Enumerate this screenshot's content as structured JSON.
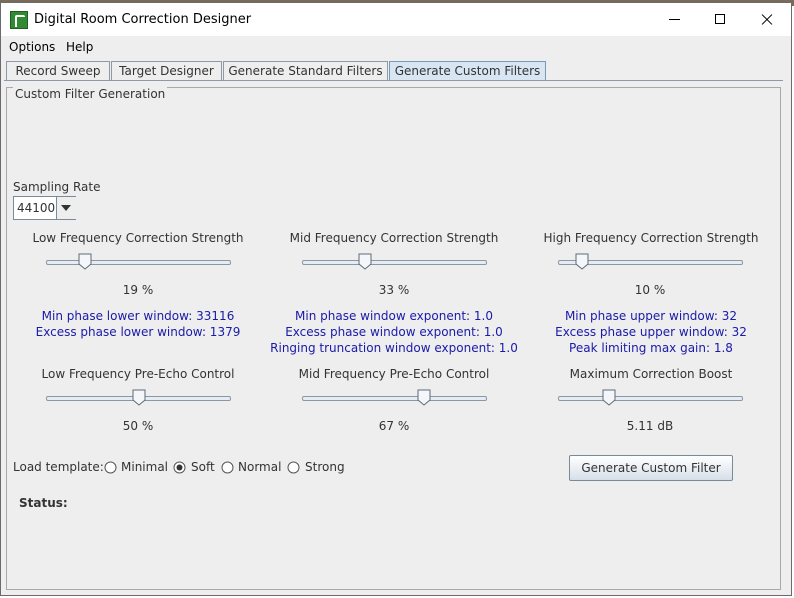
{
  "window": {
    "title": "Digital Room Correction Designer"
  },
  "menu": {
    "items": [
      "Options",
      "Help"
    ]
  },
  "tabs": [
    {
      "label": "Record Sweep",
      "active": false
    },
    {
      "label": "Target Designer",
      "active": false
    },
    {
      "label": "Generate Standard Filters",
      "active": false
    },
    {
      "label": "Generate Custom Filters",
      "active": true
    }
  ],
  "panel": {
    "title": "Custom Filter Generation"
  },
  "sampling_rate": {
    "label": "Sampling Rate",
    "value": "44100"
  },
  "sliders": {
    "low_freq_strength": {
      "title": "Low Frequency Correction Strength",
      "value_text": "19 %",
      "fraction": 0.19
    },
    "mid_freq_strength": {
      "title": "Mid Frequency Correction Strength",
      "value_text": "33 %",
      "fraction": 0.33
    },
    "high_freq_strength": {
      "title": "High Frequency Correction Strength",
      "value_text": "10 %",
      "fraction": 0.1
    },
    "low_preecho": {
      "title": "Low Frequency Pre-Echo Control",
      "value_text": "50 %",
      "fraction": 0.5
    },
    "mid_preecho": {
      "title": "Mid Frequency Pre-Echo Control",
      "value_text": "67 %",
      "fraction": 0.67
    },
    "max_boost": {
      "title": "Maximum Correction Boost",
      "value_text": "5.11 dB",
      "fraction": 0.26
    }
  },
  "info": {
    "low": [
      "Min phase lower window: 33116",
      "Excess phase lower window: 1379"
    ],
    "mid": [
      "Min phase window exponent: 1.0",
      "Excess phase window exponent: 1.0",
      "Ringing truncation window exponent: 1.0"
    ],
    "high": [
      "Min phase upper window: 32",
      "Excess phase upper window: 32",
      "Peak limiting max gain: 1.8"
    ]
  },
  "template": {
    "label": "Load template:",
    "options": [
      {
        "label": "Minimal",
        "selected": false
      },
      {
        "label": "Soft",
        "selected": true
      },
      {
        "label": "Normal",
        "selected": false
      },
      {
        "label": "Strong",
        "selected": false
      }
    ]
  },
  "generate_button": {
    "label": "Generate Custom Filter"
  },
  "status": {
    "label": "Status:"
  },
  "colors": {
    "info_text": "#1a1aaa",
    "active_tab": "#d8e6f4"
  }
}
